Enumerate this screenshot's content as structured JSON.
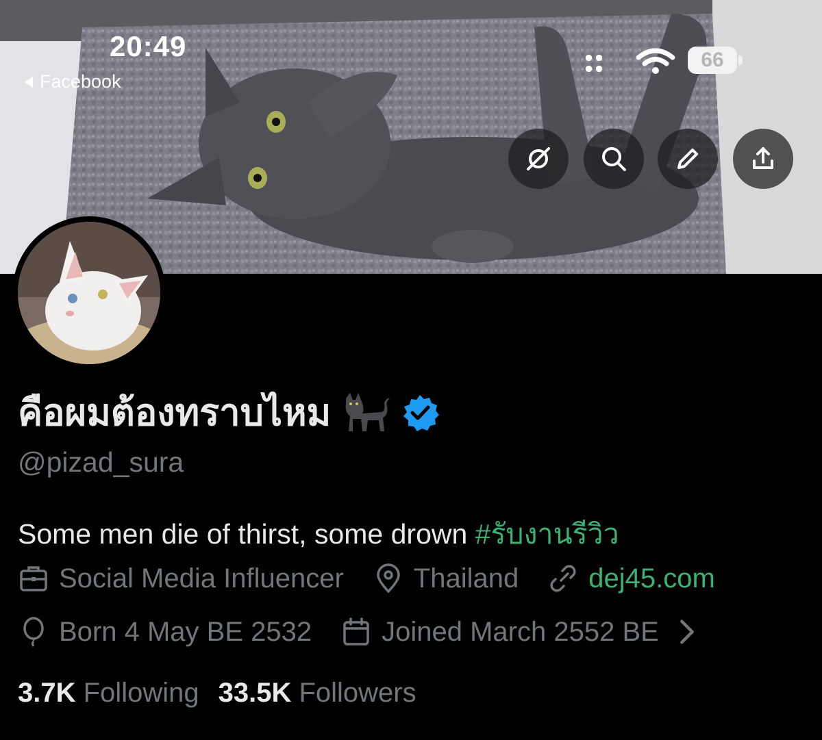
{
  "status_bar": {
    "time": "20:49",
    "back_app_label": "Facebook",
    "battery_level": "66"
  },
  "header": {
    "actions": [
      {
        "name": "grok-button",
        "icon": "grok-icon"
      },
      {
        "name": "search-button",
        "icon": "search-icon"
      },
      {
        "name": "edit-button",
        "icon": "pencil-icon"
      },
      {
        "name": "share-button",
        "icon": "share-icon"
      }
    ]
  },
  "profile": {
    "display_name": "คือผมต้องทราบไหม",
    "verified": true,
    "handle": "@pizad_sura",
    "bio_text": "Some men die of thirst, some drown ",
    "bio_hashtag": "#รับงานรีวิว",
    "category": "Social Media Influencer",
    "location": "Thailand",
    "website": "dej45.com",
    "birthday": "Born 4 May BE 2532",
    "joined": "Joined March 2552 BE"
  },
  "stats": {
    "following_count": "3.7K",
    "following_label": "Following",
    "followers_count": "33.5K",
    "followers_label": "Followers"
  },
  "colors": {
    "background": "#000000",
    "text_primary": "#e7e9ea",
    "text_secondary": "#71767b",
    "accent_green": "#3bb273",
    "verified_blue": "#1d9bf0"
  }
}
